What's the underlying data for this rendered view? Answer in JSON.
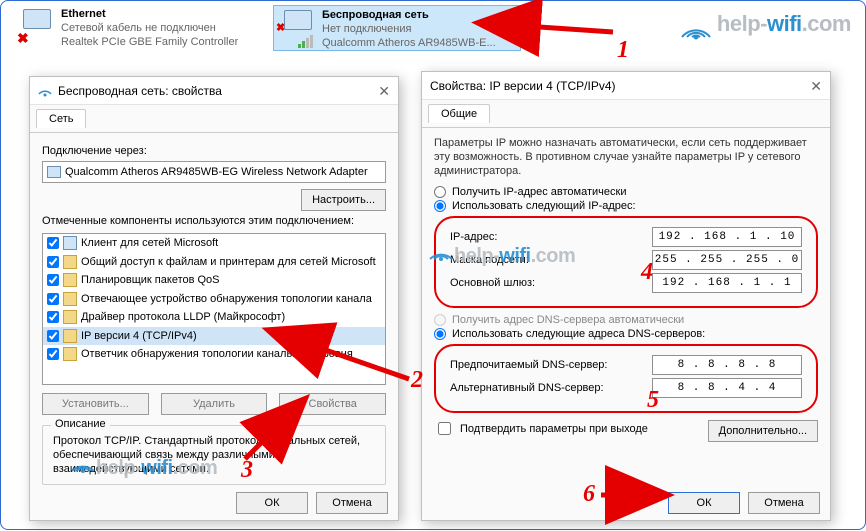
{
  "tiles": {
    "ethernet": {
      "name": "Ethernet",
      "sub1": "Сетевой кабель не подключен",
      "sub2": "Realtek PCIe GBE Family Controller"
    },
    "wifi": {
      "name": "Беспроводная сеть",
      "sub1": "Нет подключения",
      "sub2": "Qualcomm Atheros AR9485WB-E..."
    }
  },
  "logo": {
    "help": "help-",
    "wifi": "wifi",
    "com": ".com"
  },
  "steps": {
    "n1": "1",
    "n2": "2",
    "n3": "3",
    "n4": "4",
    "n5": "5",
    "n6": "6"
  },
  "leftWin": {
    "title": "Беспроводная сеть: свойства",
    "tab": "Сеть",
    "connectVia": "Подключение через:",
    "adapter": "Qualcomm Atheros AR9485WB-EG Wireless Network Adapter",
    "configure": "Настроить...",
    "componentsLabel": "Отмеченные компоненты используются этим подключением:",
    "components": [
      "Клиент для сетей Microsoft",
      "Общий доступ к файлам и принтерам для сетей Microsoft",
      "Планировщик пакетов QoS",
      "Отвечающее устройство обнаружения топологии канала",
      "Драйвер протокола LLDP (Майкрософт)",
      "IP версии 4 (TCP/IPv4)",
      "Ответчик обнаружения топологии канального уровня"
    ],
    "btnInstall": "Установить...",
    "btnRemove": "Удалить",
    "btnProps": "Свойства",
    "descTitle": "Описание",
    "desc": "Протокол TCP/IP. Стандартный протокол глобальных сетей, обеспечивающий связь между различными взаимодействующими сетями.",
    "ok": "ОК",
    "cancel": "Отмена"
  },
  "rightWin": {
    "title": "Свойства: IP версии 4 (TCP/IPv4)",
    "tab": "Общие",
    "para": "Параметры IP можно назначать автоматически, если сеть поддерживает эту возможность. В противном случае узнайте параметры IP у сетевого администратора.",
    "radioAutoIp": "Получить IP-адрес автоматически",
    "radioManIp": "Использовать следующий IP-адрес:",
    "ipLabel": "IP-адрес:",
    "ipVal": "192 . 168 .  1  . 10",
    "maskLabel": "Маска подсети:",
    "maskVal": "255 . 255 . 255 .  0",
    "gwLabel": "Основной шлюз:",
    "gwVal": "192 . 168 .  1  .  1",
    "radioAutoDns": "Получить адрес DNS-сервера автоматически",
    "radioManDns": "Использовать следующие адреса DNS-серверов:",
    "dns1Label": "Предпочитаемый DNS-сервер:",
    "dns1Val": "8  .  8  .  8  .  8",
    "dns2Label": "Альтернативный DNS-сервер:",
    "dns2Val": "8  .  8  .  4  .  4",
    "validate": "Подтвердить параметры при выходе",
    "advanced": "Дополнительно...",
    "ok": "ОК",
    "cancel": "Отмена"
  }
}
